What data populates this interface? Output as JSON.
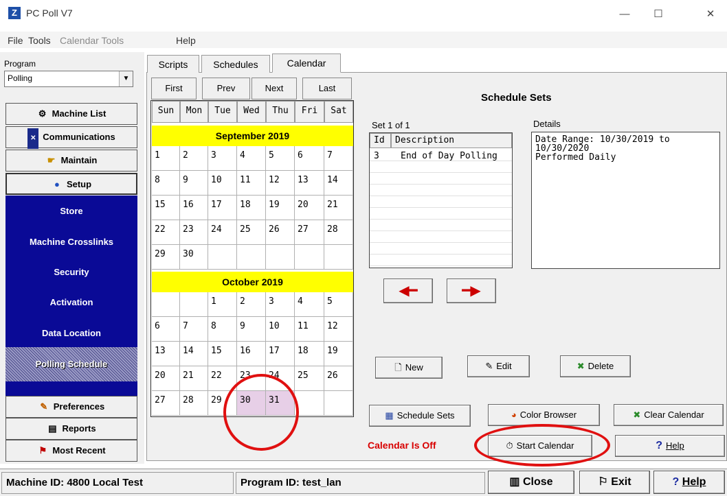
{
  "window": {
    "title": "PC Poll V7",
    "app_icon": "Z",
    "min": "—",
    "max": "☐",
    "close": "✕"
  },
  "menu": [
    "File",
    "Tools",
    "Calendar Tools",
    "Help"
  ],
  "left": {
    "program_label": "Program",
    "program_value": "Polling",
    "nav": {
      "machine_list": "Machine List",
      "communications": "Communications",
      "maintain": "Maintain",
      "setup": "Setup",
      "preferences": "Preferences",
      "reports": "Reports",
      "most_recent": "Most Recent"
    },
    "setup_items": [
      "Store",
      "Machine Crosslinks",
      "Security",
      "Activation",
      "Data Location",
      "Polling Schedule"
    ]
  },
  "tabs": [
    "Scripts",
    "Schedules",
    "Calendar"
  ],
  "calendar": {
    "nav": [
      "First",
      "Prev",
      "Next",
      "Last"
    ],
    "days": [
      "Sun",
      "Mon",
      "Tue",
      "Wed",
      "Thu",
      "Fri",
      "Sat"
    ],
    "months": [
      {
        "name": "September 2019",
        "rows": [
          [
            "1",
            "2",
            "3",
            "4",
            "5",
            "6",
            "7"
          ],
          [
            "8",
            "9",
            "10",
            "11",
            "12",
            "13",
            "14"
          ],
          [
            "15",
            "16",
            "17",
            "18",
            "19",
            "20",
            "21"
          ],
          [
            "22",
            "23",
            "24",
            "25",
            "26",
            "27",
            "28"
          ],
          [
            "29",
            "30",
            "",
            "",
            "",
            "",
            ""
          ]
        ]
      },
      {
        "name": "October 2019",
        "rows": [
          [
            "",
            "",
            "1",
            "2",
            "3",
            "4",
            "5"
          ],
          [
            "6",
            "7",
            "8",
            "9",
            "10",
            "11",
            "12"
          ],
          [
            "13",
            "14",
            "15",
            "16",
            "17",
            "18",
            "19"
          ],
          [
            "20",
            "21",
            "22",
            "23",
            "24",
            "25",
            "26"
          ],
          [
            "27",
            "28",
            "29",
            "30",
            "31",
            "",
            ""
          ]
        ]
      }
    ],
    "highlighted": [
      "30",
      "31"
    ]
  },
  "schedule": {
    "title": "Schedule Sets",
    "set_label": "Set 1 of 1",
    "details_label": "Details",
    "columns": [
      "Id",
      "Description"
    ],
    "rows": [
      {
        "id": "3",
        "desc": "End of Day Polling"
      }
    ],
    "details_lines": [
      "Date Range: 10/30/2019 to",
      "10/30/2020",
      "Performed Daily"
    ],
    "buttons": {
      "new": "New",
      "edit": "Edit",
      "delete": "Delete",
      "schedule_sets": "Schedule Sets",
      "color_browser": "Color Browser",
      "clear_calendar": "Clear Calendar",
      "start_calendar": "Start Calendar",
      "help": "Help"
    },
    "status": "Calendar Is Off"
  },
  "statusbar": {
    "machine": "Machine ID: 4800 Local Test",
    "program": "Program ID: test_lan",
    "close": "Close",
    "exit": "Exit",
    "help": "Help"
  },
  "colors": {
    "month_header": "#ffff00",
    "setup_panel": "#0a0a96",
    "highlight": "#e7cfe7",
    "annotation": "#e01010",
    "status_text": "#d80000"
  }
}
